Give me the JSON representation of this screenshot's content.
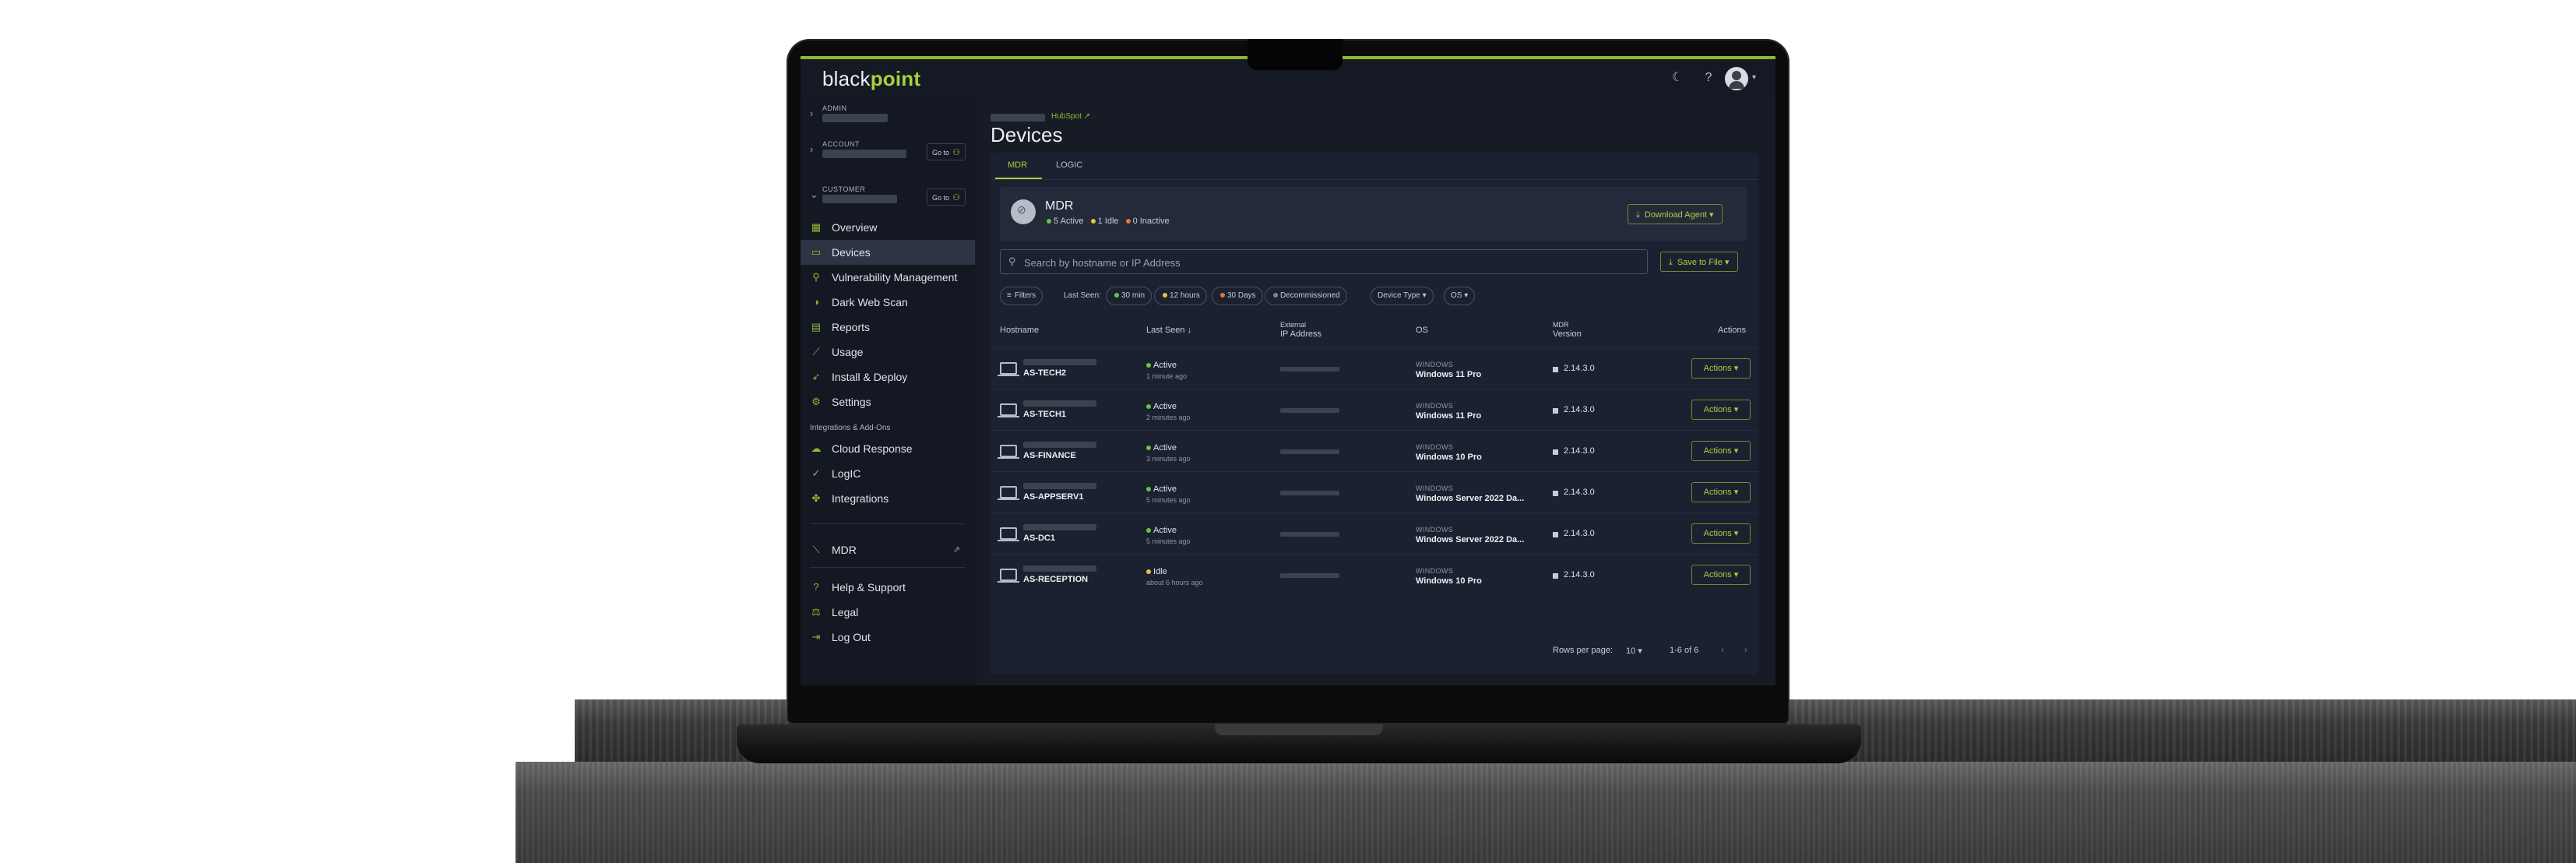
{
  "header": {
    "logo_part1": "black",
    "logo_part2": "point",
    "theme_icon": "moon-icon",
    "help_icon": "help-icon",
    "avatar_icon": "user-avatar-icon"
  },
  "sidebar": {
    "scopes": [
      {
        "label": "ADMIN",
        "goto": ""
      },
      {
        "label": "ACCOUNT",
        "goto": "Go to"
      },
      {
        "label": "CUSTOMER",
        "goto": "Go to"
      }
    ],
    "items": [
      {
        "label": "Overview",
        "icon": "dashboard-icon"
      },
      {
        "label": "Devices",
        "icon": "devices-icon"
      },
      {
        "label": "Vulnerability Management",
        "icon": "vulnerability-icon"
      },
      {
        "label": "Dark Web Scan",
        "icon": "dark-web-icon"
      },
      {
        "label": "Reports",
        "icon": "reports-icon"
      },
      {
        "label": "Usage",
        "icon": "usage-icon"
      },
      {
        "label": "Install & Deploy",
        "icon": "rocket-icon"
      },
      {
        "label": "Settings",
        "icon": "gear-icon"
      }
    ],
    "section_label": "Integrations & Add-Ons",
    "addons": [
      {
        "label": "Cloud Response",
        "icon": "cloud-icon"
      },
      {
        "label": "LogIC",
        "icon": "logic-icon"
      },
      {
        "label": "Integrations",
        "icon": "puzzle-icon"
      }
    ],
    "footer": [
      {
        "label": "MDR",
        "icon": "mdr-icon"
      },
      {
        "label": "Help & Support",
        "icon": "help-icon"
      },
      {
        "label": "Legal",
        "icon": "gavel-icon"
      },
      {
        "label": "Log Out",
        "icon": "logout-icon"
      }
    ]
  },
  "main": {
    "breadcrumb_link": "HubSpot ↗",
    "title": "Devices",
    "tabs": [
      "MDR",
      "LOGIC"
    ],
    "mdr": {
      "title": "MDR",
      "active": "5 Active",
      "idle": "1 Idle",
      "inactive": "0 Inactive",
      "download_label": "Download Agent ▾"
    },
    "search": {
      "placeholder": "Search by hostname or IP Address"
    },
    "save_label": "Save to File ▾",
    "filters_label": "Filters",
    "last_seen_label": "Last Seen:",
    "chips": [
      "30 min",
      "12 hours",
      "30 Days",
      "Decommissioned",
      "Device Type ▾",
      "OS ▾"
    ],
    "columns": {
      "hostname": "Hostname",
      "last_seen": "Last Seen ↓",
      "ip_line1": "External",
      "ip_line2": "IP Address",
      "os": "OS",
      "ver_line1": "MDR",
      "ver_line2": "Version",
      "actions": "Actions"
    },
    "rows": [
      {
        "host": "AS-TECH2",
        "status": "Active",
        "seen": "1 minute ago",
        "os_type": "WINDOWS",
        "os": "Windows 11 Pro",
        "version": "2.14.3.0",
        "action": "Actions ▾"
      },
      {
        "host": "AS-TECH1",
        "status": "Active",
        "seen": "2 minutes ago",
        "os_type": "WINDOWS",
        "os": "Windows 11 Pro",
        "version": "2.14.3.0",
        "action": "Actions ▾"
      },
      {
        "host": "AS-FINANCE",
        "status": "Active",
        "seen": "3 minutes ago",
        "os_type": "WINDOWS",
        "os": "Windows 10 Pro",
        "version": "2.14.3.0",
        "action": "Actions ▾"
      },
      {
        "host": "AS-APPSERV1",
        "status": "Active",
        "seen": "5 minutes ago",
        "os_type": "WINDOWS",
        "os": "Windows Server 2022 Da...",
        "version": "2.14.3.0",
        "action": "Actions ▾"
      },
      {
        "host": "AS-DC1",
        "status": "Active",
        "seen": "5 minutes ago",
        "os_type": "WINDOWS",
        "os": "Windows Server 2022 Da...",
        "version": "2.14.3.0",
        "action": "Actions ▾"
      },
      {
        "host": "AS-RECEPTION",
        "status": "Idle",
        "seen": "about 6 hours ago",
        "os_type": "WINDOWS",
        "os": "Windows 10 Pro",
        "version": "2.14.3.0",
        "action": "Actions ▾"
      }
    ],
    "pager": {
      "rows_label": "Rows per page:",
      "rows_value": "10 ▾",
      "range": "1-6 of 6"
    }
  },
  "colors": {
    "accent": "#a7d13b",
    "active": "#6bc04b",
    "idle": "#e8c23a",
    "inactive": "#e07a3a",
    "background": "#161b26"
  }
}
